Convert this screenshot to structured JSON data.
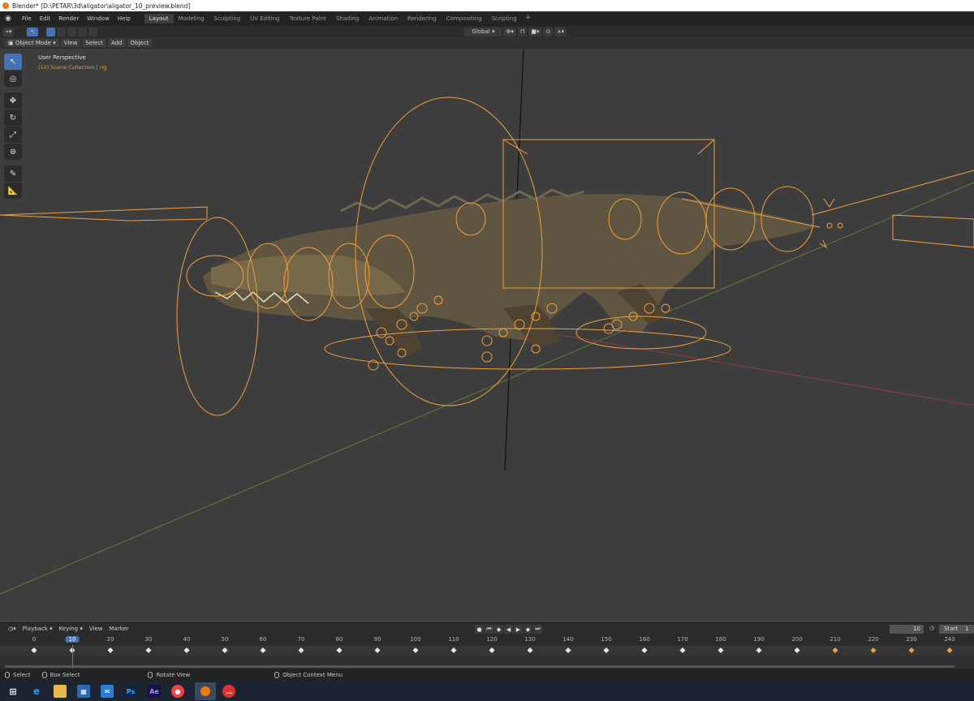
{
  "window": {
    "title": "Blender* [D:\\PETAR\\3d\\aligator\\aligator_10_preview.blend]"
  },
  "menubar": {
    "menus": [
      "File",
      "Edit",
      "Render",
      "Window",
      "Help"
    ],
    "workspaces": [
      "Layout",
      "Modeling",
      "Sculpting",
      "UV Editing",
      "Texture Paint",
      "Shading",
      "Animation",
      "Rendering",
      "Compositing",
      "Scripting"
    ],
    "active_workspace": "Layout",
    "add_label": "+"
  },
  "toolbar": {
    "transform_orientation": "Global"
  },
  "viewport_header": {
    "mode": "Object Mode",
    "menus": [
      "View",
      "Select",
      "Add",
      "Object"
    ]
  },
  "viewport": {
    "title": "User Perspective",
    "subtitle": "(10) Scene Collection | rig"
  },
  "timeline": {
    "menus": [
      "Playback",
      "Keying",
      "View",
      "Marker"
    ],
    "current_frame": "10",
    "start_label": "Start",
    "start_value": "1",
    "ruler": [
      "0",
      "10",
      "20",
      "30",
      "40",
      "50",
      "60",
      "70",
      "80",
      "90",
      "100",
      "110",
      "120",
      "130",
      "140",
      "150",
      "160",
      "170",
      "180",
      "190",
      "200",
      "210",
      "220",
      "230",
      "240"
    ],
    "keyframes": [
      0,
      10,
      20,
      30,
      40,
      50,
      60,
      70,
      80,
      90,
      100,
      110,
      120,
      130,
      140,
      150,
      160,
      170,
      180,
      190,
      200,
      210,
      220,
      230,
      240
    ],
    "selected_keyframes": [
      210,
      220,
      230,
      240
    ]
  },
  "statusbar": {
    "items": [
      "Select",
      "Box Select",
      "Rotate View",
      "Object Context Menu"
    ]
  },
  "taskbar": {
    "apps": [
      "windows-start",
      "edge",
      "file-explorer",
      "store",
      "mail",
      "photoshop",
      "after-effects",
      "chrome",
      "blender",
      "messaging"
    ]
  },
  "colors": {
    "accent": "#4772b3",
    "rig": "#f0a040",
    "subtitle": "#d6a13e"
  }
}
